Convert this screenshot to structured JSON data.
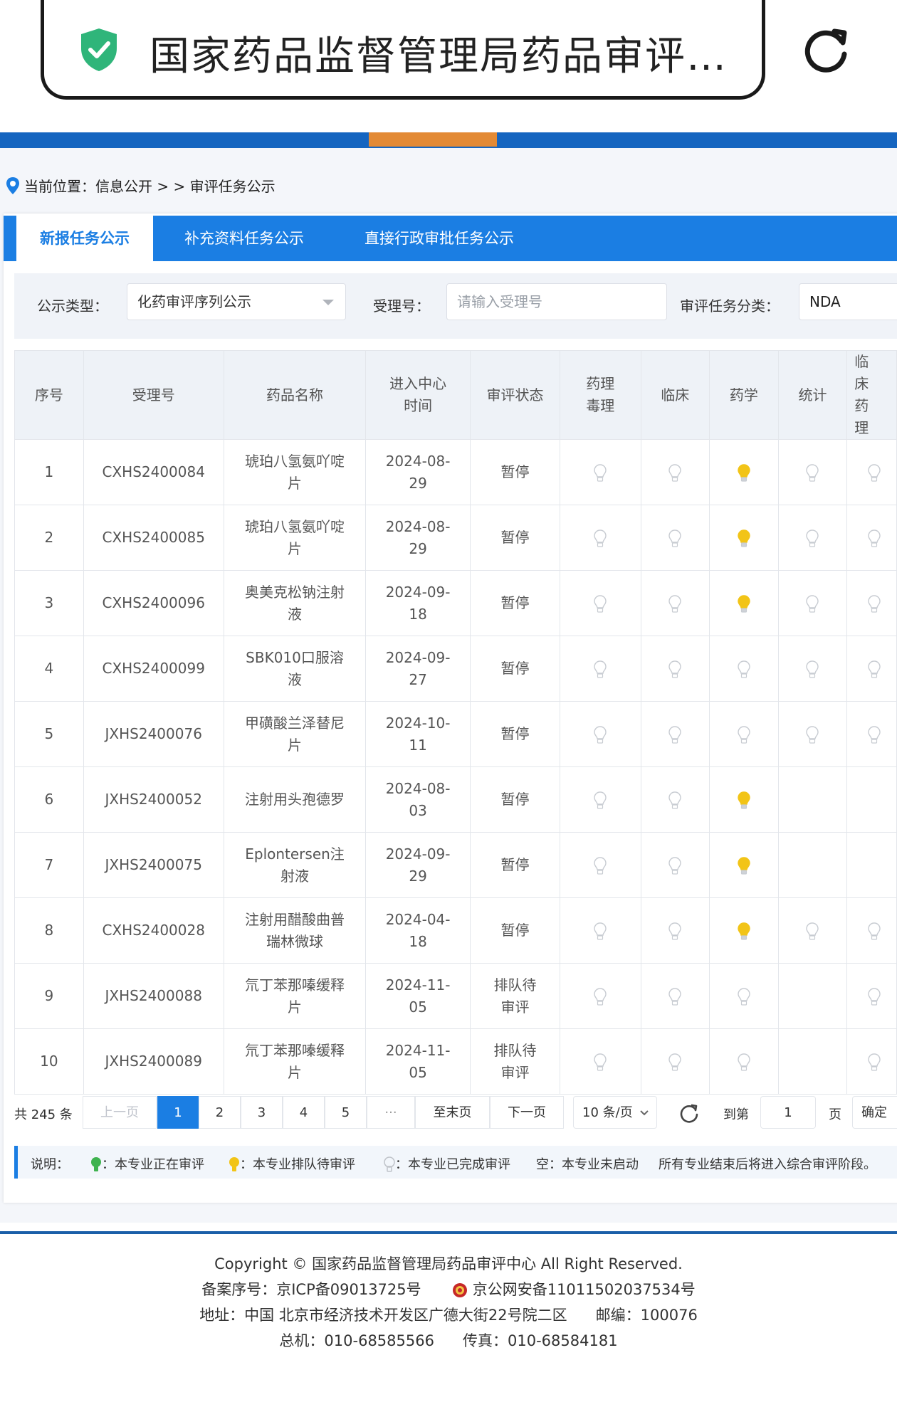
{
  "browser": {
    "url_title": "国家药品监督管理局药品审评…"
  },
  "breadcrumb": {
    "label": "当前位置：信息公开 > > 审评任务公示"
  },
  "tabs": [
    {
      "label": "新报任务公示",
      "active": true
    },
    {
      "label": "补充资料任务公示",
      "active": false
    },
    {
      "label": "直接行政审批任务公示",
      "active": false
    }
  ],
  "filters": {
    "type_label": "公示类型：",
    "type_value": "化药审评序列公示",
    "accept_label": "受理号：",
    "accept_placeholder": "请输入受理号",
    "category_label": "审评任务分类：",
    "category_value": "NDA"
  },
  "table": {
    "headers": [
      "序号",
      "受理号",
      "药品名称",
      "进入中心时间",
      "审评状态",
      "药理毒理",
      "临床",
      "药学",
      "统计",
      "临床药理"
    ],
    "rows": [
      {
        "no": "1",
        "id": "CXHS2400084",
        "name": "琥珀八氢氨吖啶片",
        "date": "2024-08-29",
        "status": "暂停",
        "pharm": "done",
        "clin": "done",
        "chem": "queue",
        "stat": "done",
        "cp": "done"
      },
      {
        "no": "2",
        "id": "CXHS2400085",
        "name": "琥珀八氢氨吖啶片",
        "date": "2024-08-29",
        "status": "暂停",
        "pharm": "done",
        "clin": "done",
        "chem": "queue",
        "stat": "done",
        "cp": "done"
      },
      {
        "no": "3",
        "id": "CXHS2400096",
        "name": "奥美克松钠注射液",
        "date": "2024-09-18",
        "status": "暂停",
        "pharm": "done",
        "clin": "done",
        "chem": "queue",
        "stat": "done",
        "cp": "done"
      },
      {
        "no": "4",
        "id": "CXHS2400099",
        "name": "SBK010口服溶液",
        "date": "2024-09-27",
        "status": "暂停",
        "pharm": "done",
        "clin": "done",
        "chem": "done",
        "stat": "done",
        "cp": "done"
      },
      {
        "no": "5",
        "id": "JXHS2400076",
        "name": "甲磺酸兰泽替尼片",
        "date": "2024-10-11",
        "status": "暂停",
        "pharm": "done",
        "clin": "done",
        "chem": "done",
        "stat": "done",
        "cp": "done"
      },
      {
        "no": "6",
        "id": "JXHS2400052",
        "name": "注射用头孢德罗",
        "date": "2024-08-03",
        "status": "暂停",
        "pharm": "done",
        "clin": "done",
        "chem": "queue",
        "stat": "none",
        "cp": "none"
      },
      {
        "no": "7",
        "id": "JXHS2400075",
        "name": "Eplontersen注射液",
        "date": "2024-09-29",
        "status": "暂停",
        "pharm": "done",
        "clin": "done",
        "chem": "queue",
        "stat": "none",
        "cp": "none"
      },
      {
        "no": "8",
        "id": "CXHS2400028",
        "name": "注射用醋酸曲普瑞林微球",
        "date": "2024-04-18",
        "status": "暂停",
        "pharm": "done",
        "clin": "done",
        "chem": "queue",
        "stat": "done",
        "cp": "done"
      },
      {
        "no": "9",
        "id": "JXHS2400088",
        "name": "氘丁苯那嗪缓释片",
        "date": "2024-11-05",
        "status": "排队待审评",
        "pharm": "done",
        "clin": "done",
        "chem": "done",
        "stat": "none",
        "cp": "done"
      },
      {
        "no": "10",
        "id": "JXHS2400089",
        "name": "氘丁苯那嗪缓释片",
        "date": "2024-11-05",
        "status": "排队待审评",
        "pharm": "done",
        "clin": "done",
        "chem": "done",
        "stat": "none",
        "cp": "done"
      }
    ]
  },
  "pager": {
    "total": "共 245 条",
    "prev": "上一页",
    "pages": [
      "1",
      "2",
      "3",
      "4",
      "5",
      "···"
    ],
    "current": "1",
    "last": "至末页",
    "next": "下一页",
    "page_size": "10 条/页",
    "goto_label": "到第",
    "goto_value": "1",
    "page_unit": "页",
    "confirm": "确定"
  },
  "legend": {
    "title": "说明：",
    "active": "：本专业正在审评",
    "queue": "：本专业排队待审评",
    "done": "：本专业已完成审评",
    "empty": "空：本专业未启动",
    "note": "所有专业结束后将进入综合审评阶段。"
  },
  "footer": {
    "copyright": "Copyright © 国家药品监督管理局药品审评中心   All Right Reserved.",
    "icp": "备案序号：京ICP备09013725号",
    "police": "京公网安备11011502037534号",
    "address": "地址：中国 北京市经济技术开发区广德大街22号院二区      邮编：100076",
    "phone": "总机：010-68585566      传真：010-68584181"
  },
  "colors": {
    "primary": "#1b7ee3",
    "banner": "#1565c0",
    "accent": "#e38a35",
    "bulb_active": "#3fb34f",
    "bulb_queue": "#f2c417",
    "bulb_done": "#d6d9de"
  }
}
